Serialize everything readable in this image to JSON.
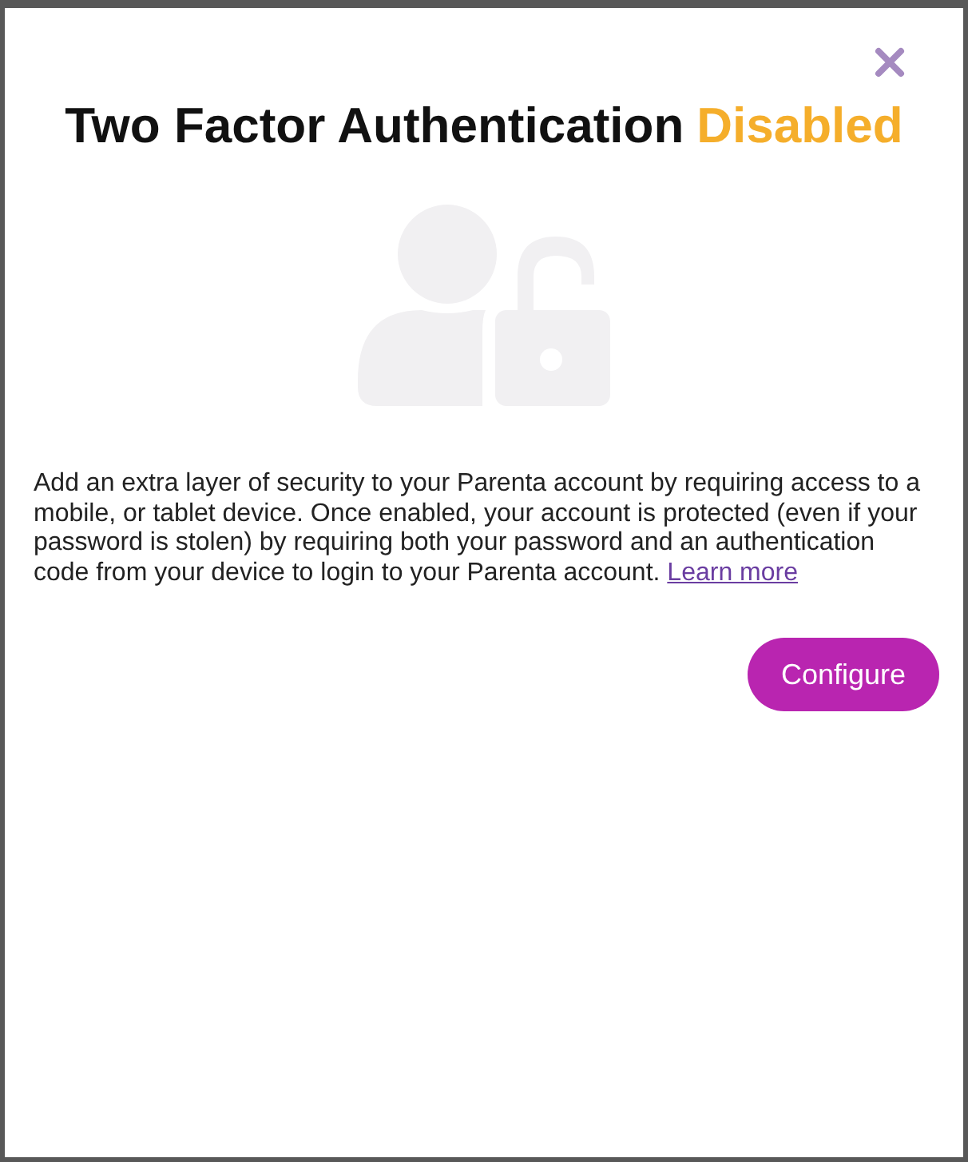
{
  "dialog": {
    "title": "Two Factor Authentication",
    "status": {
      "label": "Disabled",
      "kind": "disabled"
    },
    "description": "Add an extra layer of security to your Parenta account by requiring access to a mobile, or tablet device. Once enabled, your account is protected (even if your password is stolen) by requiring both your password and an authentication code from your device to login to your Parenta account.",
    "link": "Learn more",
    "button": "Configure"
  }
}
